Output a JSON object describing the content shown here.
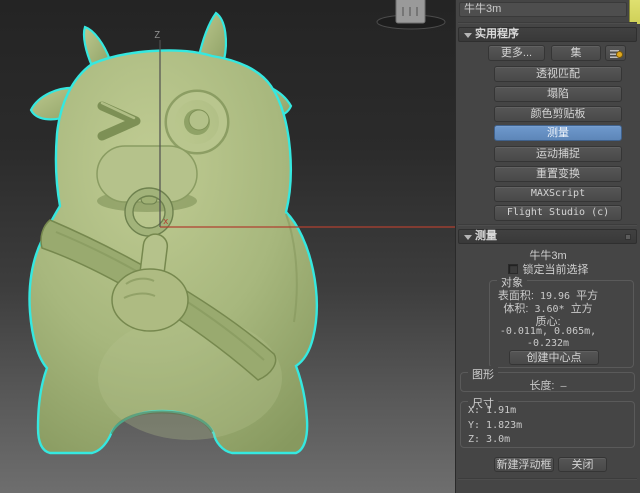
{
  "titlebar": {
    "object_name": "牛牛3m"
  },
  "utilities": {
    "rollout_title": "实用程序",
    "more_label": "更多...",
    "sets_label": "集",
    "config_icon": "utility-config-icon",
    "buttons": [
      "透视匹配",
      "塌陷",
      "颜色剪贴板",
      "测量",
      "运动捕捉",
      "重置变换",
      "MAXScript",
      "Flight Studio (c)"
    ],
    "active_button": "测量"
  },
  "measure": {
    "rollout_title": "测量",
    "object_name": "牛牛3m",
    "lock_label": "锁定当前选择",
    "lock_checked": false,
    "object_group": {
      "label": "对象",
      "surface_area_label": "表面积:",
      "surface_area_value": "19.96",
      "surface_area_unit": "平方",
      "volume_label": "体积:",
      "volume_value": "3.60*",
      "volume_unit": "立方",
      "center_of_mass_label": "质心:",
      "center_of_mass_line1": "-0.011m, 0.065m,",
      "center_of_mass_line2": "-0.232m",
      "create_center_label": "创建中心点"
    },
    "shapes_group": {
      "label": "图形",
      "length_label": "长度:",
      "length_value": "—"
    },
    "dimensions_group": {
      "label": "尺寸",
      "x": "X: 1.91m",
      "y": "Y: 1.823m",
      "z": "Z: 3.0m"
    },
    "new_floater_label": "新建浮动框",
    "close_label": "关闭"
  },
  "viewport": {
    "model_name": "牛牛3m",
    "axis_z_label": "Z",
    "axis_x_label": "x"
  },
  "colors": {
    "selection_outline": "#35e8e0",
    "model_base": "#a7b77d",
    "active_button_blue": "#5d86b8",
    "accent_yellow": "#d9da63",
    "x_axis_red": "#b04030"
  }
}
